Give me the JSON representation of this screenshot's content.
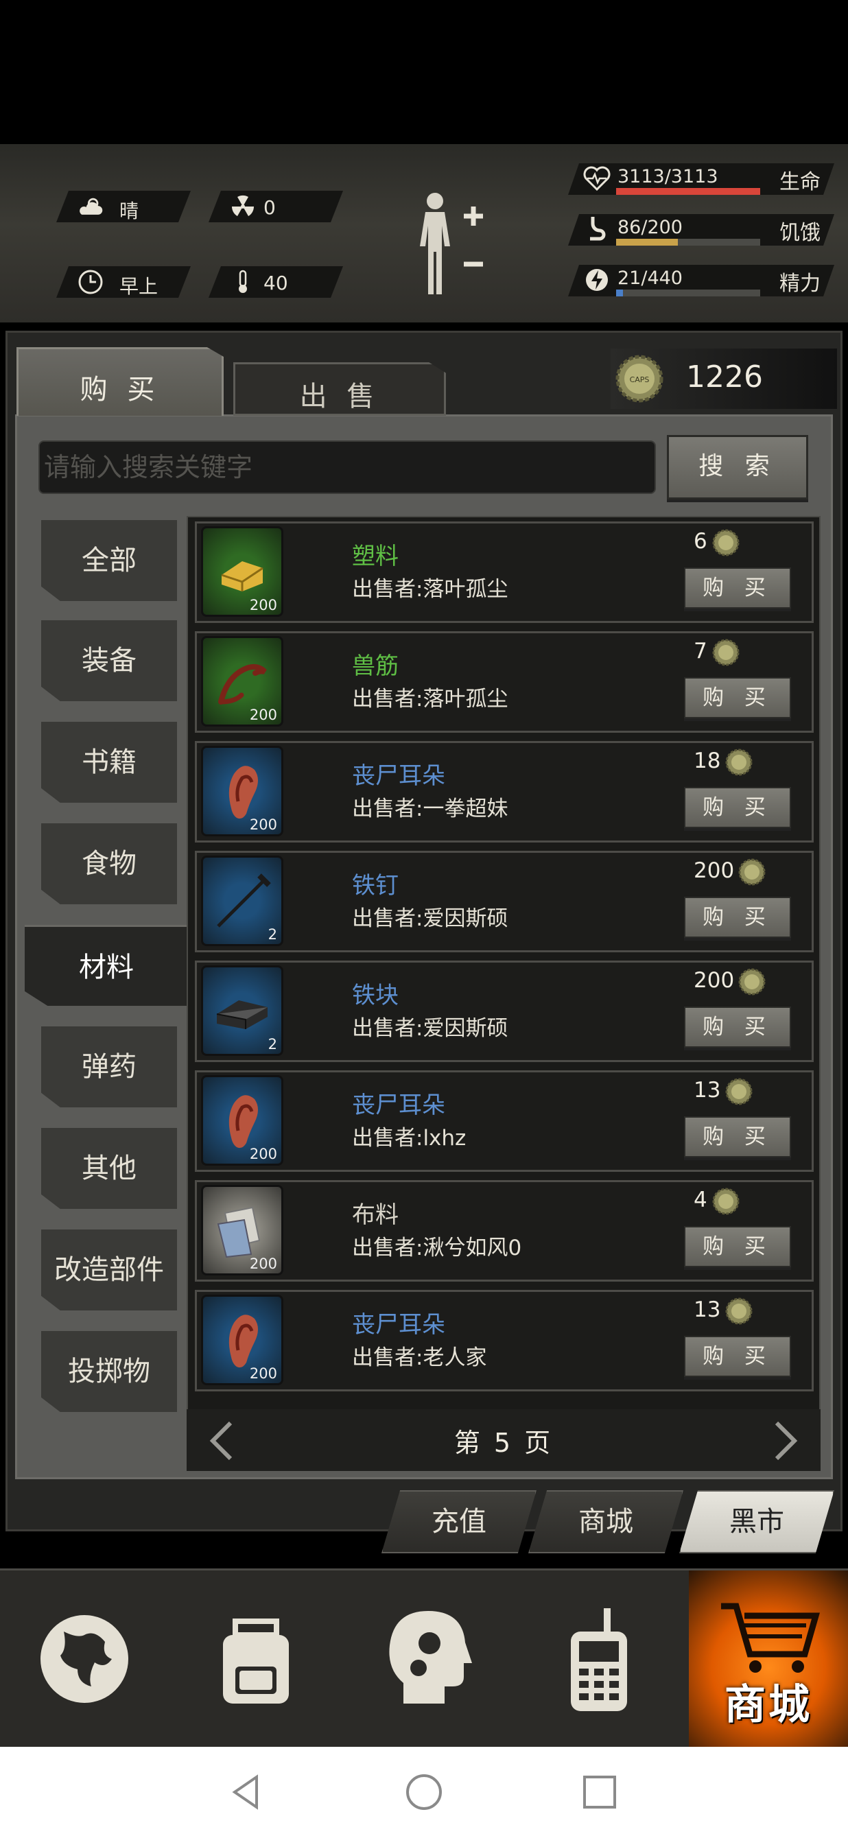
{
  "status": {
    "weather": "晴",
    "radiation": "0",
    "time_of_day": "早上",
    "temperature": "40",
    "health": {
      "value": "3113/3113",
      "label": "生命",
      "fraction": 1.0,
      "color": "#d9463a"
    },
    "hunger": {
      "value": "86/200",
      "label": "饥饿",
      "fraction": 0.43,
      "color": "#c9a24a"
    },
    "energy": {
      "value": "21/440",
      "label": "精力",
      "fraction": 0.048,
      "color": "#4a7fc9"
    }
  },
  "tabs": {
    "buy": "购 买",
    "sell": "出 售"
  },
  "currency": {
    "amount": "1226"
  },
  "search": {
    "placeholder": "请输入搜索关键字",
    "button": "搜 索"
  },
  "categories": [
    "全部",
    "装备",
    "书籍",
    "食物",
    "材料",
    "弹药",
    "其他",
    "改造部件",
    "投掷物"
  ],
  "active_category": "材料",
  "items": [
    {
      "name": "塑料",
      "seller": "出售者:落叶孤尘",
      "price": "6",
      "qty": "200",
      "name_color": "#5fbf45",
      "icon": "plastic-icon",
      "rarity_color": "#2f6b23"
    },
    {
      "name": "兽筋",
      "seller": "出售者:落叶孤尘",
      "price": "7",
      "qty": "200",
      "name_color": "#5fbf45",
      "icon": "tendon-icon",
      "rarity_color": "#2f6b23"
    },
    {
      "name": "丧尸耳朵",
      "seller": "出售者:一拳超妹",
      "price": "18",
      "qty": "200",
      "name_color": "#5d8fd0",
      "icon": "zombie-ear-icon",
      "rarity_color": "#1e4f7a"
    },
    {
      "name": "铁钉",
      "seller": "出售者:爱因斯硕",
      "price": "200",
      "qty": "2",
      "name_color": "#5d8fd0",
      "icon": "nail-icon",
      "rarity_color": "#1e4f7a"
    },
    {
      "name": "铁块",
      "seller": "出售者:爱因斯硕",
      "price": "200",
      "qty": "2",
      "name_color": "#5d8fd0",
      "icon": "iron-block-icon",
      "rarity_color": "#1e4f7a"
    },
    {
      "name": "丧尸耳朵",
      "seller": "出售者:lxhz",
      "price": "13",
      "qty": "200",
      "name_color": "#5d8fd0",
      "icon": "zombie-ear-icon",
      "rarity_color": "#1e4f7a"
    },
    {
      "name": "布料",
      "seller": "出售者:湫兮如风0",
      "price": "4",
      "qty": "200",
      "name_color": "#d8d4c8",
      "icon": "cloth-icon",
      "rarity_color": "#8a8880"
    },
    {
      "name": "丧尸耳朵",
      "seller": "出售者:老人家",
      "price": "13",
      "qty": "200",
      "name_color": "#5d8fd0",
      "icon": "zombie-ear-icon",
      "rarity_color": "#1e4f7a"
    }
  ],
  "buy_label": "购 买",
  "pager": {
    "label": "第 5 页"
  },
  "market_tabs": [
    "充值",
    "商城",
    "黑市"
  ],
  "active_market_tab": "黑市",
  "nav": {
    "shop_label": "商城"
  }
}
